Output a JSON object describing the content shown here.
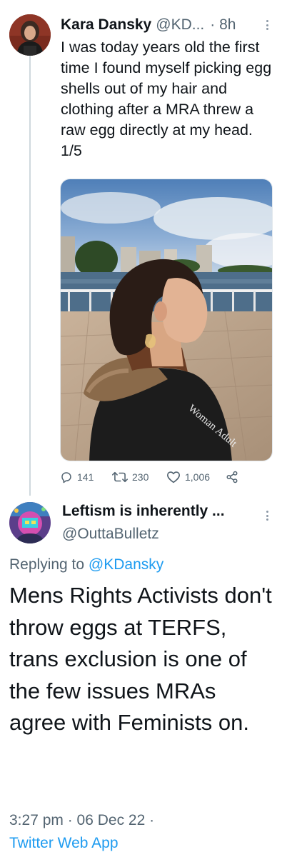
{
  "tweet1": {
    "author_name": "Kara Dansky",
    "author_handle": "@KD...",
    "time": "· 8h",
    "text": "I was today years old the first time I found myself picking egg shells out of my hair and clothing after a MRA threw a raw egg directly at my head. 1/5",
    "photo_vest_text": "Woman Adult",
    "stats": {
      "replies": "141",
      "retweets": "230",
      "likes": "1,006"
    }
  },
  "tweet2": {
    "author_name": "Leftism is inherently ...",
    "author_handle": "@OuttaBulletz",
    "replying_prefix": "Replying to ",
    "replying_to": "@KDansky",
    "text": "Mens Rights Activists don't throw eggs at TERFS, trans exclusion is one of the few issues MRAs agree with Feminists on.",
    "timestamp": "3:27 pm · 06 Dec 22 ·",
    "source": "Twitter Web App"
  },
  "icons": {
    "reply": "reply-icon",
    "retweet": "retweet-icon",
    "like": "heart-icon",
    "share": "share-icon",
    "more": "more-dots-icon"
  },
  "colors": {
    "link": "#1d9bf0",
    "secondary_text": "#536471",
    "primary_text": "#0f1419",
    "thread_line": "#cfd9de"
  }
}
